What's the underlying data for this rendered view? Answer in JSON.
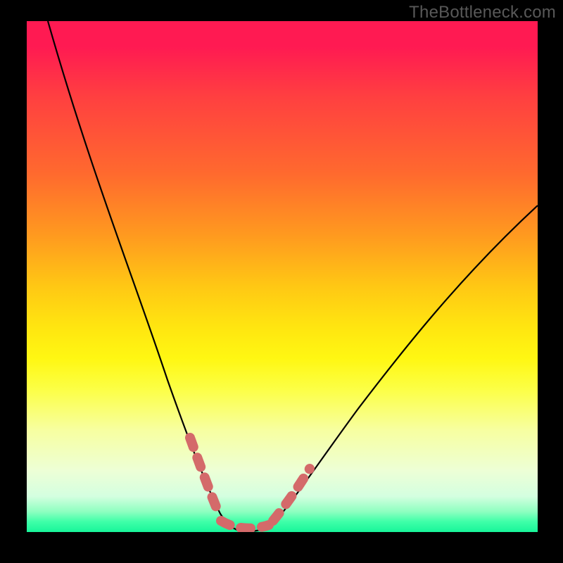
{
  "watermark": "TheBottleneck.com",
  "chart_data": {
    "type": "line",
    "title": "",
    "xlabel": "",
    "ylabel": "",
    "xlim": [
      0,
      100
    ],
    "ylim": [
      0,
      100
    ],
    "series": [
      {
        "name": "bottleneck-curve",
        "x": [
          0,
          5,
          10,
          15,
          20,
          25,
          29,
          32,
          34,
          36,
          38,
          40,
          42,
          44,
          46,
          50,
          55,
          60,
          65,
          70,
          75,
          80,
          85,
          90,
          95,
          100
        ],
        "values": [
          100,
          88,
          75,
          62,
          49,
          36,
          24,
          15,
          9,
          4,
          1,
          0,
          0,
          0,
          1,
          4,
          10,
          17,
          24,
          31,
          38,
          44,
          50,
          55,
          60,
          65
        ]
      }
    ],
    "annotations": [
      {
        "name": "left-dash-marker",
        "x_range": [
          31,
          36
        ],
        "style": "dashed-salmon"
      },
      {
        "name": "floor-dash-marker",
        "x_range": [
          36,
          46
        ],
        "style": "dashed-salmon"
      },
      {
        "name": "right-dash-marker",
        "x_range": [
          46,
          52
        ],
        "style": "dashed-salmon"
      }
    ],
    "background_gradient": {
      "top_color": "#ff1a52",
      "mid_color": "#fff712",
      "bottom_color": "#18f59a"
    }
  }
}
